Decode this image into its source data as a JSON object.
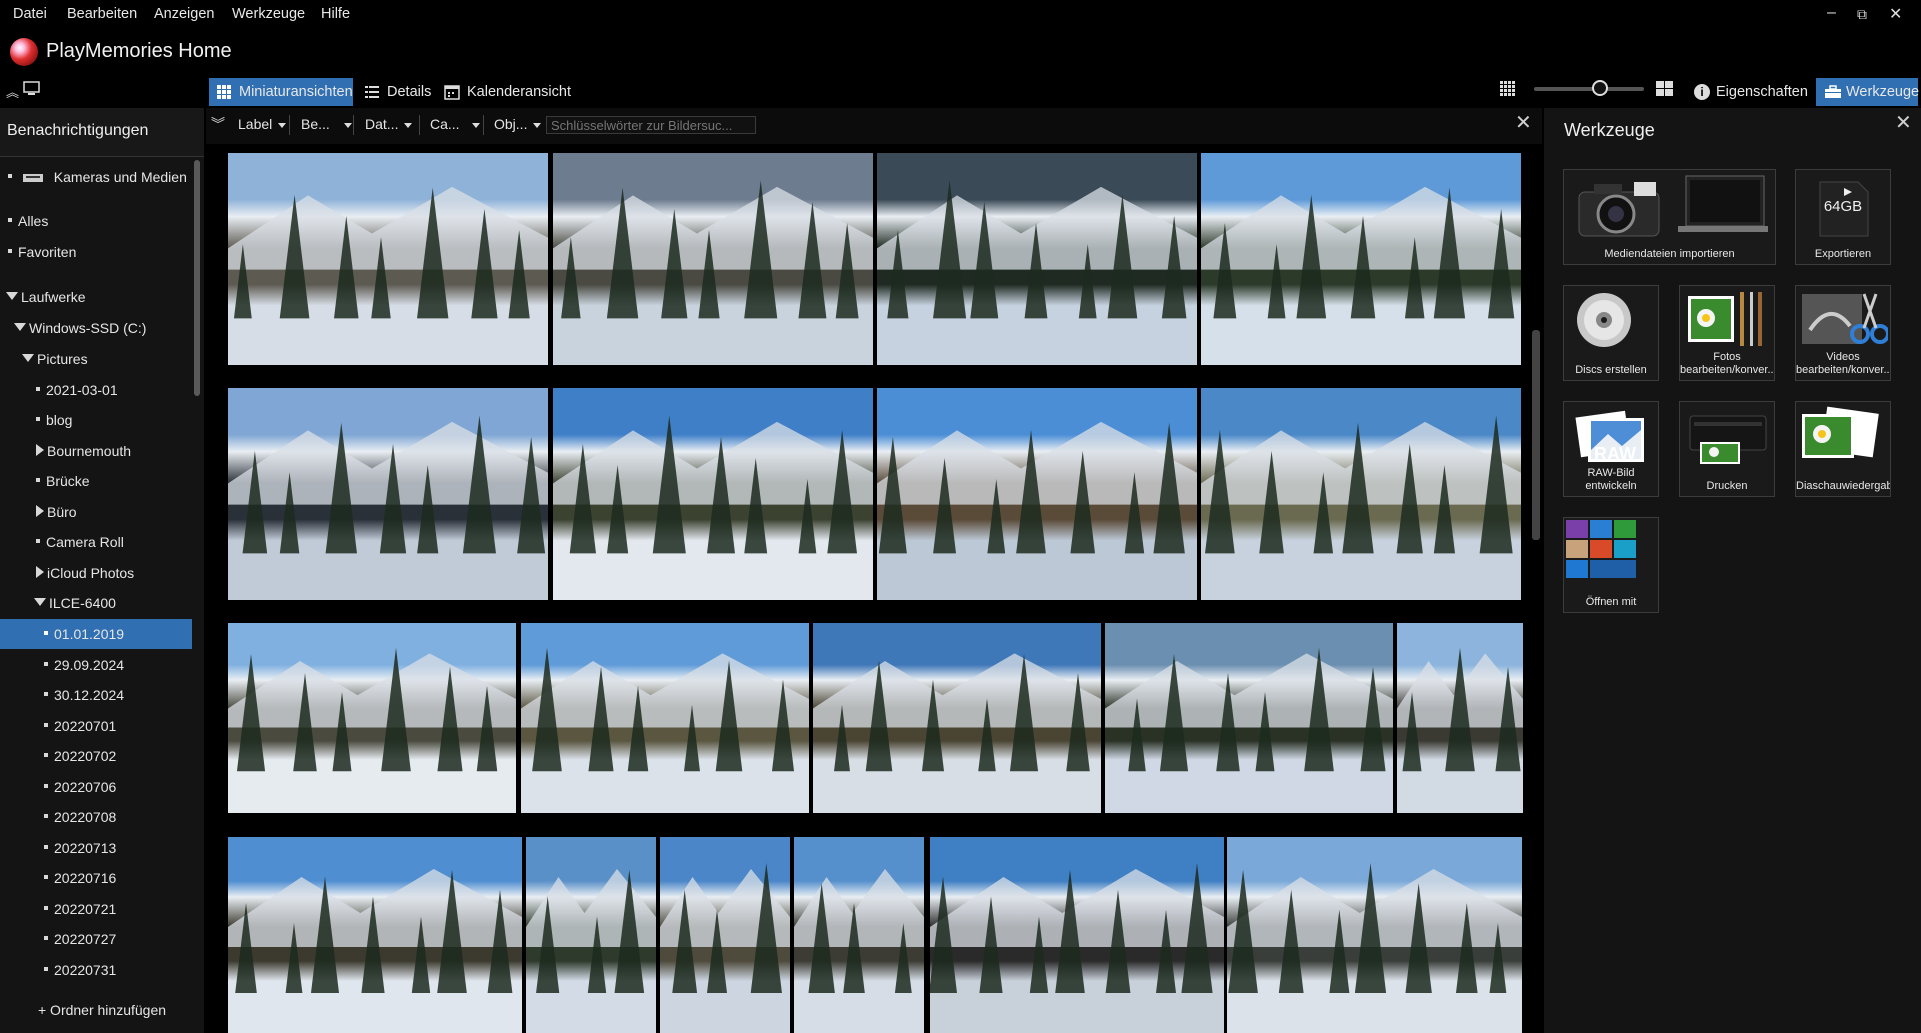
{
  "menu": [
    "Datei",
    "Bearbeiten",
    "Anzeigen",
    "Werkzeuge",
    "Hilfe"
  ],
  "window_controls": {
    "minimize": "–",
    "restore": "⧉",
    "close": "✕"
  },
  "app": {
    "title": "PlayMemories Home"
  },
  "view_tabs": [
    {
      "label": "Miniaturansichten",
      "icon": "grid-icon",
      "active": true
    },
    {
      "label": "Details",
      "icon": "list-icon",
      "active": false
    },
    {
      "label": "Kalenderansicht",
      "icon": "calendar-icon",
      "active": false
    }
  ],
  "right_toolbar": {
    "properties_label": "Eigenschaften",
    "tools_label": "Werkzeuge",
    "zoom_level": 0.6
  },
  "sidebar": {
    "header": "Benachrichtigungen",
    "cameras_label": "Kameras und Medien",
    "items": [
      {
        "label": "Alles",
        "type": "bullet"
      },
      {
        "label": "Favoriten",
        "type": "bullet"
      }
    ],
    "drives_label": "Laufwerke",
    "drive_label": "Windows-SSD (C:)",
    "pictures_label": "Pictures",
    "folders": [
      {
        "label": "2021-03-01",
        "type": "bullet"
      },
      {
        "label": "blog",
        "type": "bullet"
      },
      {
        "label": "Bournemouth",
        "type": "collapsed"
      },
      {
        "label": "Brücke",
        "type": "bullet"
      },
      {
        "label": "Büro",
        "type": "collapsed"
      },
      {
        "label": "Camera Roll",
        "type": "bullet"
      },
      {
        "label": "iCloud Photos",
        "type": "collapsed"
      }
    ],
    "ilce_label": "ILCE-6400",
    "ilce_children": [
      {
        "label": "01.01.2019",
        "selected": true
      },
      {
        "label": "29.09.2024",
        "selected": false
      },
      {
        "label": "30.12.2024",
        "selected": false
      },
      {
        "label": "20220701",
        "selected": false
      },
      {
        "label": "20220702",
        "selected": false
      },
      {
        "label": "20220706",
        "selected": false
      },
      {
        "label": "20220708",
        "selected": false
      },
      {
        "label": "20220713",
        "selected": false
      },
      {
        "label": "20220716",
        "selected": false
      },
      {
        "label": "20220721",
        "selected": false
      },
      {
        "label": "20220727",
        "selected": false
      },
      {
        "label": "20220731",
        "selected": false
      }
    ],
    "add_folder": "+ Ordner hinzufügen"
  },
  "filter": {
    "label": "Label",
    "be": "Be...",
    "dat": "Dat...",
    "ca": "Ca...",
    "obj": "Obj...",
    "search_placeholder": "Schlüsselwörter zur Bildersuc..."
  },
  "tools_panel": {
    "title": "Werkzeuge",
    "tools": [
      {
        "label": "Mediendateien importieren",
        "icon": "camera-laptop-icon"
      },
      {
        "label": "Exportieren",
        "icon": "sd-card-icon",
        "badge": "64GB"
      },
      {
        "label": "Discs erstellen",
        "icon": "disc-icon"
      },
      {
        "label": "Fotos bearbeiten/konver...",
        "icon": "photo-edit-icon"
      },
      {
        "label": "Videos bearbeiten/konver...",
        "icon": "video-edit-icon"
      },
      {
        "label": "RAW-Bild entwickeln",
        "icon": "raw-icon",
        "badge": "RAW"
      },
      {
        "label": "Drucken",
        "icon": "printer-icon"
      },
      {
        "label": "Diaschauwiedergabe",
        "icon": "slideshow-icon"
      },
      {
        "label": "Öffnen mit",
        "icon": "open-with-icon"
      }
    ]
  },
  "thumbnails": [
    {
      "name": "photo-1",
      "colors": [
        "#8fb3d8",
        "#5d5a52",
        "#d7dde6"
      ]
    },
    {
      "name": "photo-2",
      "colors": [
        "#6d7c8f",
        "#4a4a42",
        "#c9d3de"
      ]
    },
    {
      "name": "photo-3",
      "colors": [
        "#3a4a57",
        "#1f2a22",
        "#c6d2df"
      ]
    },
    {
      "name": "photo-4",
      "colors": [
        "#5e9ad8",
        "#2c3a2a",
        "#d6e0ea"
      ]
    },
    {
      "name": "photo-5",
      "colors": [
        "#7fa6d4",
        "#2a3038",
        "#c1cbd8"
      ]
    },
    {
      "name": "photo-6",
      "colors": [
        "#3f7fc8",
        "#3c4230",
        "#e3e8ef"
      ]
    },
    {
      "name": "photo-7",
      "colors": [
        "#4b8ed6",
        "#5a4a38",
        "#bcc8d6"
      ]
    },
    {
      "name": "photo-8",
      "colors": [
        "#4a88c8",
        "#6a6a50",
        "#c8d2de"
      ]
    },
    {
      "name": "photo-9",
      "colors": [
        "#7fb0e0",
        "#4a4a3e",
        "#e6ebf0"
      ]
    },
    {
      "name": "photo-10",
      "colors": [
        "#5f9bd8",
        "#5a5640",
        "#dbe2ea"
      ]
    },
    {
      "name": "photo-11",
      "colors": [
        "#3f78b8",
        "#4a4432",
        "#d8dee6"
      ]
    },
    {
      "name": "photo-12",
      "colors": [
        "#6b8fb0",
        "#2a3226",
        "#cfd8e4"
      ]
    },
    {
      "name": "photo-13",
      "colors": [
        "#8cb4dc",
        "#3a3a32",
        "#d2dae4"
      ]
    },
    {
      "name": "photo-14",
      "colors": [
        "#4f8ed0",
        "#3c3a2e",
        "#e0e6ee"
      ]
    },
    {
      "name": "photo-15",
      "colors": [
        "#5a90c8",
        "#2e3a2c",
        "#d3dbe6"
      ]
    },
    {
      "name": "photo-16",
      "colors": [
        "#4a86c8",
        "#4e4a3c",
        "#ccd5e0"
      ]
    },
    {
      "name": "photo-17",
      "colors": [
        "#5590cc",
        "#3c3c34",
        "#d6dde6"
      ]
    },
    {
      "name": "photo-18",
      "colors": [
        "#3f7fc4",
        "#2a2a2a",
        "#c8d0da"
      ]
    },
    {
      "name": "photo-19",
      "colors": [
        "#7aa8d8",
        "#3a3e3a",
        "#dce2ea"
      ]
    }
  ]
}
